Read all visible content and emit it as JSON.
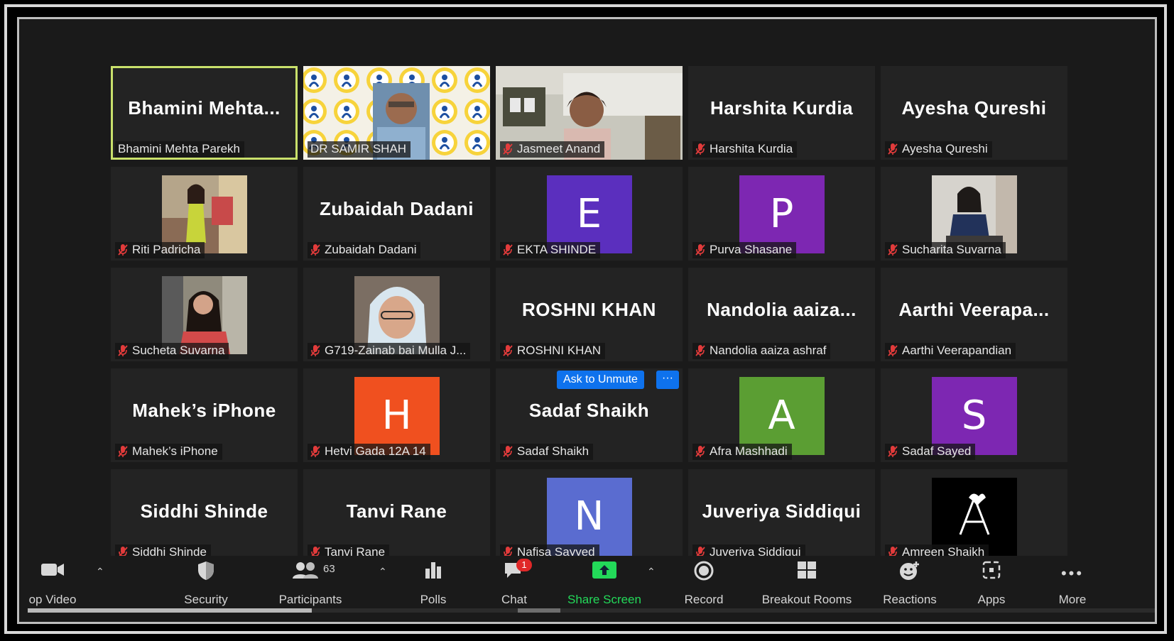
{
  "accent_color": "#c9e06b",
  "participants_grid": [
    {
      "display_name": "Bhamini  Mehta...",
      "label": "Bhamini Mehta Parekh",
      "type": "name",
      "active": true,
      "muted": false
    },
    {
      "display_name": "",
      "label": "DR SAMIR SHAH",
      "type": "video-logo",
      "muted": false
    },
    {
      "display_name": "",
      "label": "Jasmeet Anand",
      "type": "video-room",
      "muted": true
    },
    {
      "display_name": "Harshita Kurdia",
      "label": "Harshita Kurdia",
      "type": "name",
      "muted": true
    },
    {
      "display_name": "Ayesha Qureshi",
      "label": "Ayesha Qureshi",
      "type": "name",
      "muted": true
    },
    {
      "display_name": "",
      "label": "Riti Padricha",
      "type": "photo-yellow",
      "muted": true
    },
    {
      "display_name": "Zubaidah Dadani",
      "label": "Zubaidah Dadani",
      "type": "name",
      "muted": true
    },
    {
      "display_name": "E",
      "label": "EKTA SHINDE",
      "type": "avatar",
      "color": "#5b2fbe",
      "muted": true
    },
    {
      "display_name": "P",
      "label": "Purva Shasane",
      "type": "avatar",
      "color": "#7d27b2",
      "muted": true
    },
    {
      "display_name": "",
      "label": "Sucharita Suvarna",
      "type": "photo-desk",
      "muted": true
    },
    {
      "display_name": "",
      "label": "Sucheta Suvarna",
      "type": "photo-red",
      "muted": true
    },
    {
      "display_name": "",
      "label": "G719-Zainab bai Mulla J...",
      "type": "photo-hijab",
      "muted": true
    },
    {
      "display_name": "ROSHNI KHAN",
      "label": "ROSHNI KHAN",
      "type": "name",
      "muted": true
    },
    {
      "display_name": "Nandolia  aaiza...",
      "label": "Nandolia aaiza ashraf",
      "type": "name",
      "muted": true
    },
    {
      "display_name": "Aarthi  Veerapa...",
      "label": "Aarthi Veerapandian",
      "type": "name",
      "muted": true
    },
    {
      "display_name": "Mahek’s iPhone",
      "label": "Mahek’s iPhone",
      "type": "name",
      "muted": true
    },
    {
      "display_name": "H",
      "label": "Hetvi Gada 12A 14",
      "type": "avatar",
      "color": "#f0501f",
      "muted": true
    },
    {
      "display_name": "Sadaf Shaikh",
      "label": "Sadaf Shaikh",
      "type": "name",
      "muted": true,
      "hover": true
    },
    {
      "display_name": "A",
      "label": "Afra Mashhadi",
      "type": "avatar",
      "color": "#5b9e33",
      "muted": true
    },
    {
      "display_name": "S",
      "label": "Sadaf Sayed",
      "type": "avatar",
      "color": "#7d27b2",
      "muted": true
    },
    {
      "display_name": "Siddhi Shinde",
      "label": "Siddhi Shinde",
      "type": "name",
      "muted": true
    },
    {
      "display_name": "Tanvi Rane",
      "label": "Tanvi Rane",
      "type": "name",
      "muted": true
    },
    {
      "display_name": "N",
      "label": "Nafisa Sayyed",
      "type": "avatar",
      "color": "#5a6cd0",
      "muted": true
    },
    {
      "display_name": "Juveriya Siddiqui",
      "label": "Juveriya Siddiqui",
      "type": "name",
      "muted": true
    },
    {
      "display_name": "",
      "label": "Amreen Shaikh",
      "type": "photo-logo-a",
      "muted": true
    }
  ],
  "hover_controls": {
    "ask_to_unmute": "Ask to Unmute",
    "more": "···"
  },
  "toolbar": {
    "stop_video": "op Video",
    "security": "Security",
    "participants": "Participants",
    "participants_count": "63",
    "polls": "Polls",
    "chat": "Chat",
    "chat_badge": "1",
    "share_screen": "Share Screen",
    "record": "Record",
    "breakout_rooms": "Breakout Rooms",
    "reactions": "Reactions",
    "apps": "Apps",
    "more": "More",
    "share_color": "#23d959"
  }
}
